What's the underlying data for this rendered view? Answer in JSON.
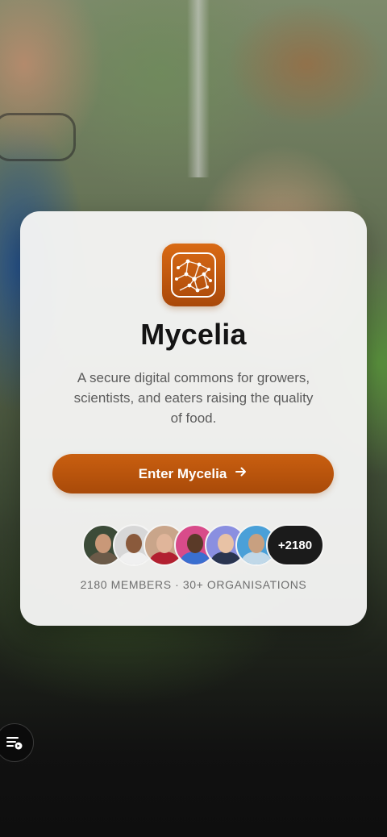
{
  "app": {
    "name": "Mycelia",
    "tagline": "A secure digital commons for growers, scientists, and eaters raising the quality of food."
  },
  "cta": {
    "label": "Enter Mycelia",
    "icon": "arrow-right-icon"
  },
  "members": {
    "avatars": [
      {
        "name": "member-avatar-1",
        "skin": "#c99878",
        "bg": "#3c4b38",
        "shirt": "#6b5a48"
      },
      {
        "name": "member-avatar-2",
        "skin": "#8a5a3c",
        "bg": "#d7d7d7",
        "shirt": "#f0f0f0"
      },
      {
        "name": "member-avatar-3",
        "skin": "#e0b59a",
        "bg": "#c9a58a",
        "shirt": "#b22030"
      },
      {
        "name": "member-avatar-4",
        "skin": "#5a3a28",
        "bg": "#d84b8a",
        "shirt": "#3a6fd0"
      },
      {
        "name": "member-avatar-5",
        "skin": "#e8c2a5",
        "bg": "#8a8fe0",
        "shirt": "#2a3550"
      },
      {
        "name": "member-avatar-6",
        "skin": "#c8a080",
        "bg": "#4aa0d8",
        "shirt": "#c0d8e8"
      }
    ],
    "more_label": "+2180",
    "stats": "2180 MEMBERS · 30+ ORGANISATIONS"
  },
  "colors": {
    "accent": "#b8520c",
    "card": "#f5f5f4",
    "dark": "#1b1b1b"
  },
  "fab": {
    "icon": "playlist-icon"
  }
}
